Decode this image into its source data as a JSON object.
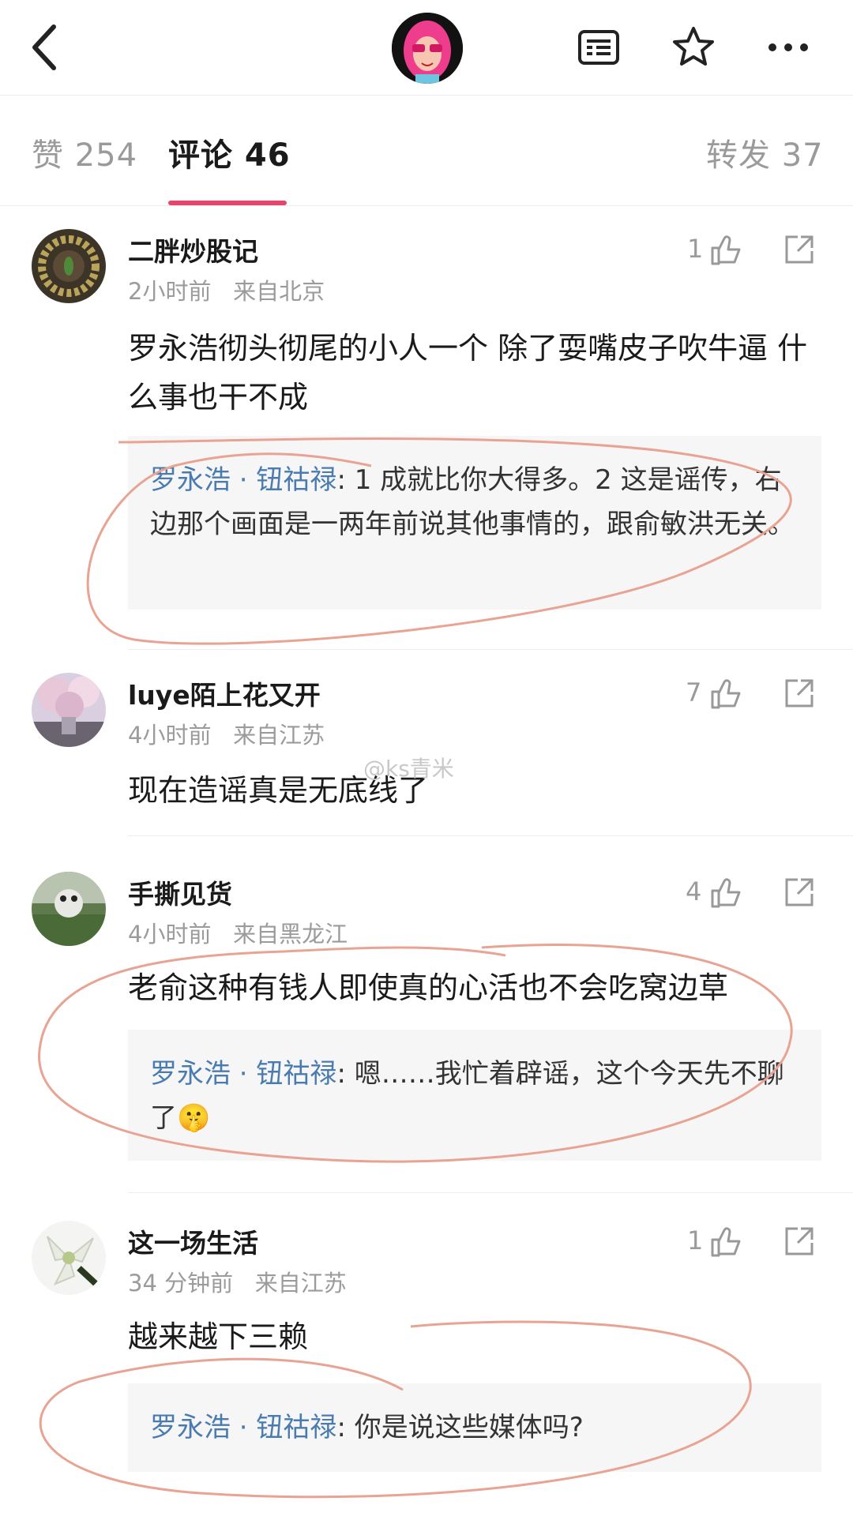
{
  "header": {
    "back_icon": "chevron-left-icon",
    "avatar_icon": "pink-hair-avatar",
    "menu_icon": "list-card-icon",
    "star_icon": "star-outline-icon",
    "more_icon": "ellipsis-icon"
  },
  "tabs": {
    "likes": "赞 254",
    "comments": "评论 46",
    "reposts": "转发 37",
    "active_color": "#e5456a"
  },
  "comments": [
    {
      "username": "二胖炒股记",
      "time": "2小时前",
      "location": "来自北京",
      "likes": "1",
      "text": "罗永浩彻头彻尾的小人一个 除了耍嘴皮子吹牛逼 什么事也干不成",
      "reply": {
        "author": "罗永浩 · 钮祜禄",
        "text": ": 1 成就比你大得多。2 这是谣传，右边那个画面是一两年前说其他事情的，跟俞敏洪无关。"
      }
    },
    {
      "username": "luye陌上花又开",
      "time": "4小时前",
      "location": "来自江苏",
      "likes": "7",
      "text": "现在造谣真是无底线了"
    },
    {
      "username": "手撕见货",
      "time": "4小时前",
      "location": "来自黑龙江",
      "likes": "4",
      "text": "老俞这种有钱人即使真的心活也不会吃窝边草",
      "reply": {
        "author": "罗永浩 · 钮祜禄",
        "text": ": 嗯……我忙着辟谣，这个今天先不聊了🤫"
      }
    },
    {
      "username": "这一场生活",
      "time": "34 分钟前",
      "location": "来自江苏",
      "likes": "1",
      "text": "越来越下三赖",
      "reply": {
        "author": "罗永浩 · 钮祜禄",
        "text": ": 你是说这些媒体吗?"
      }
    }
  ],
  "watermark": "@ks青米",
  "colors": {
    "link": "#4a7bb0",
    "annotation": "#e8a393"
  }
}
